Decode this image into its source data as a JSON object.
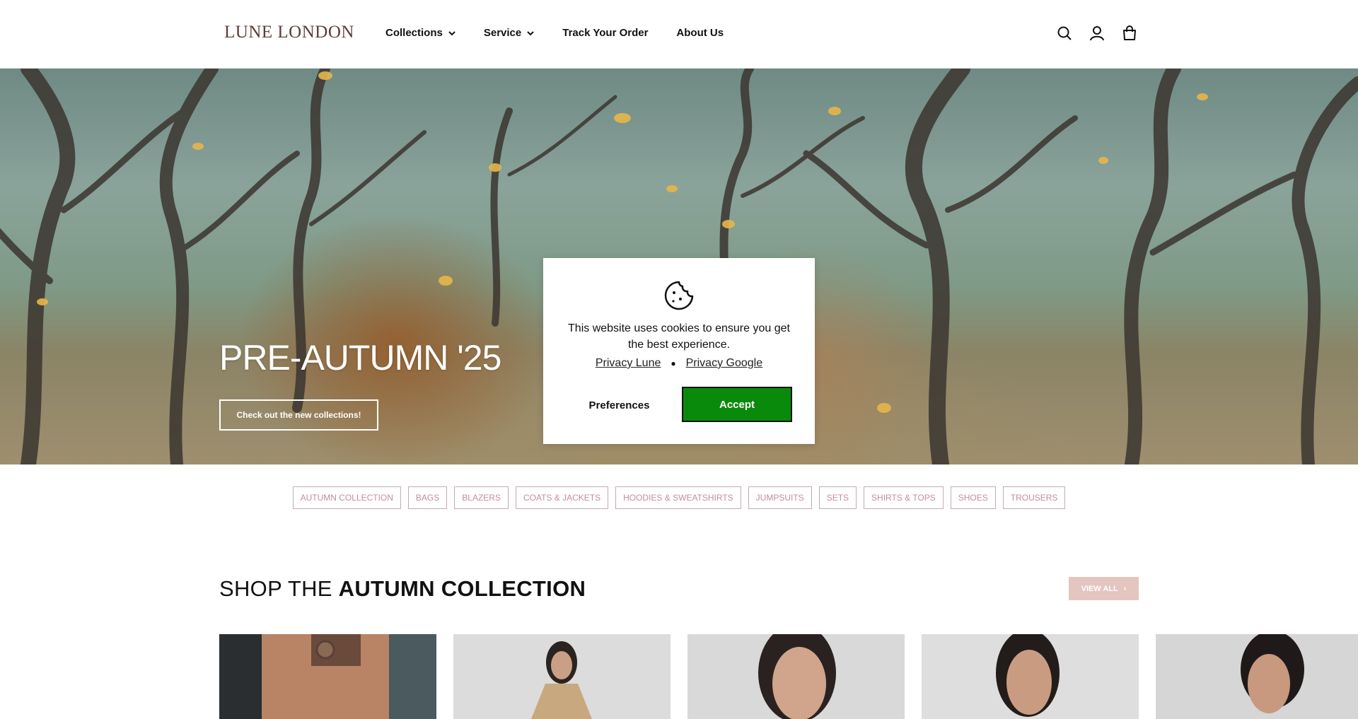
{
  "header": {
    "logo": "LUNE LONDON",
    "nav": [
      {
        "label": "Collections",
        "has_dropdown": true
      },
      {
        "label": "Service",
        "has_dropdown": true
      },
      {
        "label": "Track Your Order",
        "has_dropdown": false
      },
      {
        "label": "About Us",
        "has_dropdown": false
      }
    ],
    "icons": [
      "search-icon",
      "account-icon",
      "cart-icon"
    ]
  },
  "hero": {
    "title": "PRE-AUTUMN '25",
    "cta": "Check out the new collections!"
  },
  "cookie_banner": {
    "icon": "cookie-icon",
    "message": "This website uses cookies to ensure you get the best experience.",
    "links": [
      "Privacy Lune",
      "Privacy Google"
    ],
    "preferences_label": "Preferences",
    "accept_label": "Accept",
    "accept_color": "#0a8a0a"
  },
  "categories": [
    "AUTUMN COLLECTION",
    "BAGS",
    "BLAZERS",
    "COATS & JACKETS",
    "HOODIES & SWEATSHIRTS",
    "JUMPSUITS",
    "SETS",
    "SHIRTS & TOPS",
    "SHOES",
    "TROUSERS"
  ],
  "section": {
    "title_light": "SHOP THE ",
    "title_bold": "AUTUMN COLLECTION",
    "view_all": "VIEW ALL",
    "view_all_icon": "chevron-right-icon"
  },
  "products": [
    {
      "name": "product-1"
    },
    {
      "name": "product-2"
    },
    {
      "name": "product-3"
    },
    {
      "name": "product-4"
    },
    {
      "name": "product-5"
    }
  ]
}
